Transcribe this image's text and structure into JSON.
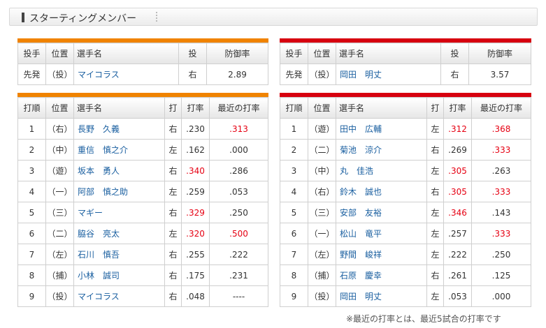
{
  "section_title": "スターティングメンバー",
  "pitcher_headers": [
    "投手",
    "位置",
    "選手名",
    "投",
    "防御率"
  ],
  "batter_headers": [
    "打順",
    "位置",
    "選手名",
    "打",
    "打率",
    "最近の打率"
  ],
  "left": {
    "pitcher": {
      "role": "先発",
      "pos": "（投）",
      "name": "マイコラス",
      "hand": "右",
      "era": "2.89"
    },
    "batters": [
      {
        "order": "1",
        "pos": "（右）",
        "name": "長野　久義",
        "hand": "右",
        "avg": ".230",
        "avg_hi": false,
        "recent": ".313",
        "recent_hi": true
      },
      {
        "order": "2",
        "pos": "（中）",
        "name": "重信　慎之介",
        "hand": "左",
        "avg": ".162",
        "avg_hi": false,
        "recent": ".000",
        "recent_hi": false
      },
      {
        "order": "3",
        "pos": "（遊）",
        "name": "坂本　勇人",
        "hand": "右",
        "avg": ".340",
        "avg_hi": true,
        "recent": ".286",
        "recent_hi": false
      },
      {
        "order": "4",
        "pos": "（一）",
        "name": "阿部　慎之助",
        "hand": "左",
        "avg": ".259",
        "avg_hi": false,
        "recent": ".053",
        "recent_hi": false
      },
      {
        "order": "5",
        "pos": "（三）",
        "name": "マギー",
        "hand": "右",
        "avg": ".329",
        "avg_hi": true,
        "recent": ".250",
        "recent_hi": false
      },
      {
        "order": "6",
        "pos": "（二）",
        "name": "脇谷　亮太",
        "hand": "左",
        "avg": ".320",
        "avg_hi": true,
        "recent": ".500",
        "recent_hi": true
      },
      {
        "order": "7",
        "pos": "（左）",
        "name": "石川　慎吾",
        "hand": "右",
        "avg": ".255",
        "avg_hi": false,
        "recent": ".222",
        "recent_hi": false
      },
      {
        "order": "8",
        "pos": "（捕）",
        "name": "小林　誠司",
        "hand": "右",
        "avg": ".175",
        "avg_hi": false,
        "recent": ".231",
        "recent_hi": false
      },
      {
        "order": "9",
        "pos": "（投）",
        "name": "マイコラス",
        "hand": "右",
        "avg": ".048",
        "avg_hi": false,
        "recent": "----",
        "recent_hi": false
      }
    ]
  },
  "right": {
    "pitcher": {
      "role": "先発",
      "pos": "（投）",
      "name": "岡田　明丈",
      "hand": "右",
      "era": "3.57"
    },
    "batters": [
      {
        "order": "1",
        "pos": "（遊）",
        "name": "田中　広輔",
        "hand": "左",
        "avg": ".312",
        "avg_hi": true,
        "recent": ".368",
        "recent_hi": true
      },
      {
        "order": "2",
        "pos": "（二）",
        "name": "菊池　涼介",
        "hand": "右",
        "avg": ".269",
        "avg_hi": false,
        "recent": ".333",
        "recent_hi": true
      },
      {
        "order": "3",
        "pos": "（中）",
        "name": "丸　佳浩",
        "hand": "左",
        "avg": ".305",
        "avg_hi": true,
        "recent": ".263",
        "recent_hi": false
      },
      {
        "order": "4",
        "pos": "（右）",
        "name": "鈴木　誠也",
        "hand": "右",
        "avg": ".305",
        "avg_hi": true,
        "recent": ".333",
        "recent_hi": true
      },
      {
        "order": "5",
        "pos": "（三）",
        "name": "安部　友裕",
        "hand": "左",
        "avg": ".346",
        "avg_hi": true,
        "recent": ".143",
        "recent_hi": false
      },
      {
        "order": "6",
        "pos": "（一）",
        "name": "松山　竜平",
        "hand": "左",
        "avg": ".257",
        "avg_hi": false,
        "recent": ".333",
        "recent_hi": true
      },
      {
        "order": "7",
        "pos": "（左）",
        "name": "野間　峻祥",
        "hand": "左",
        "avg": ".222",
        "avg_hi": false,
        "recent": ".250",
        "recent_hi": false
      },
      {
        "order": "8",
        "pos": "（捕）",
        "name": "石原　慶幸",
        "hand": "右",
        "avg": ".261",
        "avg_hi": false,
        "recent": ".125",
        "recent_hi": false
      },
      {
        "order": "9",
        "pos": "（投）",
        "name": "岡田　明丈",
        "hand": "左",
        "avg": ".053",
        "avg_hi": false,
        "recent": ".000",
        "recent_hi": false
      }
    ]
  },
  "footnote": "※最近の打率とは、最近5試合の打率です",
  "colors": {
    "left_team": "#f08300",
    "right_team": "#d7000f",
    "highlight": "#e60012",
    "link": "#1a5fa0"
  }
}
